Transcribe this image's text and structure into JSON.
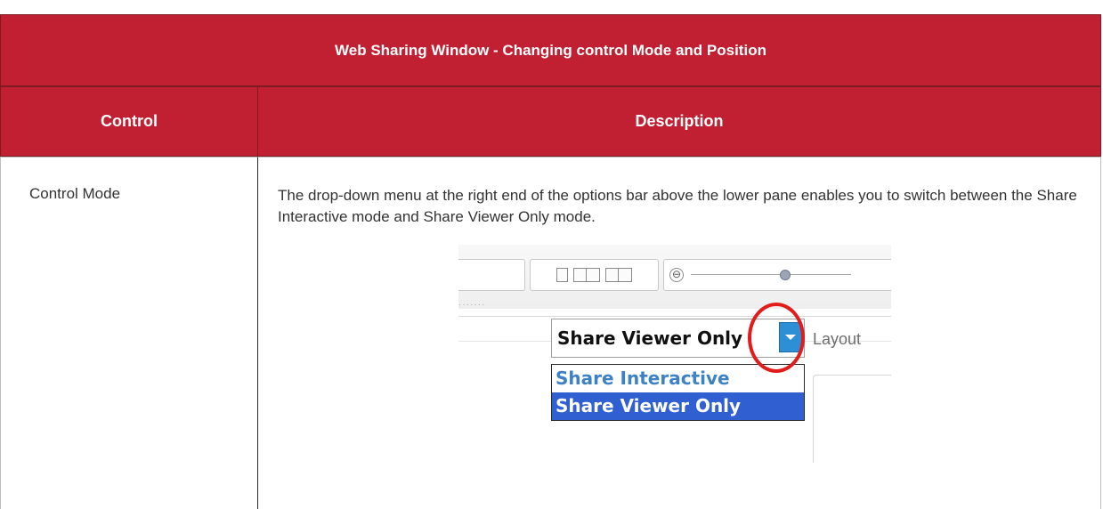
{
  "table": {
    "title": "Web Sharing Window - Changing control Mode and Position",
    "col_control": "Control",
    "col_description": "Description",
    "rows": [
      {
        "control": "Control Mode",
        "description": "The drop-down menu at the right end of the options bar above the lower pane enables you to switch between the Share Interactive mode and Share Viewer Only mode."
      }
    ]
  },
  "screenshot": {
    "selected_mode": "Share Viewer Only",
    "layout_label": "Layout",
    "options": [
      "Share Interactive",
      "Share Viewer Only"
    ],
    "dots": "·······",
    "zoom_minus": "⊖",
    "highlight_color": "#e21b1b",
    "accent_color": "#2d8fd5",
    "header_color": "#c02032"
  }
}
